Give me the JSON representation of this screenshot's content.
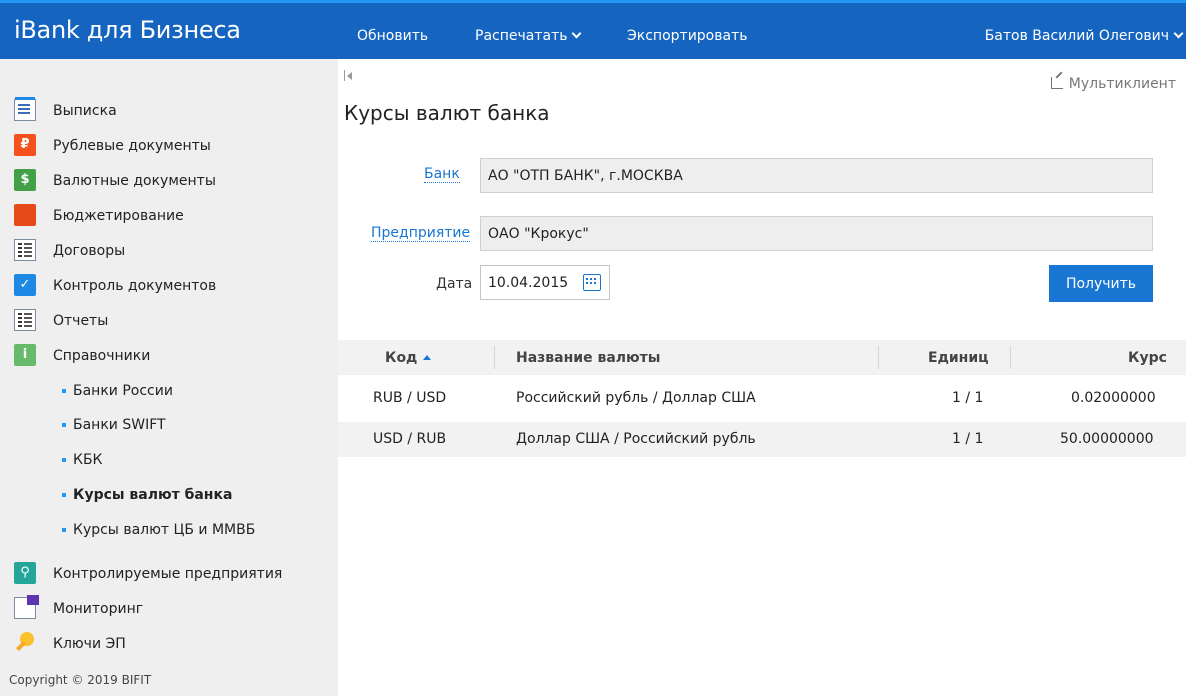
{
  "app": {
    "title": "iBank для Бизнеса"
  },
  "topnav": {
    "refresh": "Обновить",
    "print": "Распечатать",
    "export": "Экспортировать",
    "user": "Батов Василий Олегович"
  },
  "sidebar": {
    "items": [
      {
        "label": "Выписка",
        "icon": "statement-icon"
      },
      {
        "label": "Рублевые документы",
        "icon": "ruble-documents-icon"
      },
      {
        "label": "Валютные документы",
        "icon": "currency-documents-icon"
      },
      {
        "label": "Бюджетирование",
        "icon": "budget-icon"
      },
      {
        "label": "Договоры",
        "icon": "contracts-icon"
      },
      {
        "label": "Контроль документов",
        "icon": "document-control-icon"
      },
      {
        "label": "Отчеты",
        "icon": "reports-icon"
      },
      {
        "label": "Справочники",
        "icon": "directories-icon"
      }
    ],
    "subitems": [
      {
        "label": "Банки России"
      },
      {
        "label": "Банки SWIFT"
      },
      {
        "label": "КБК"
      },
      {
        "label": "Курсы валют банка",
        "active": true
      },
      {
        "label": "Курсы валют ЦБ и ММВБ"
      }
    ],
    "items_bottom": [
      {
        "label": "Контролируемые предприятия",
        "icon": "controlled-companies-icon"
      },
      {
        "label": "Мониторинг",
        "icon": "monitoring-icon"
      },
      {
        "label": "Ключи ЭП",
        "icon": "key-icon"
      }
    ],
    "copyright": "Copyright © 2019 BIFIT"
  },
  "main": {
    "multiclient": "Мультиклиент",
    "title": "Курсы валют банка",
    "bank_label": "Банк",
    "bank_value": "АО \"ОТП БАНК\", г.МОСКВА",
    "company_label": "Предприятие",
    "company_value": "ОАО \"Крокус\"",
    "date_label": "Дата",
    "date_value": "10.04.2015",
    "get_button": "Получить"
  },
  "table": {
    "columns": [
      "Код",
      "Название валюты",
      "Единиц",
      "Курс"
    ],
    "sort_column": "Код",
    "sort_dir": "asc",
    "rows": [
      {
        "code": "RUB / USD",
        "name": "Российский рубль / Доллар США",
        "units": "1 / 1",
        "rate": "0.02000000"
      },
      {
        "code": "USD / RUB",
        "name": "Доллар США / Российский рубль",
        "units": "1 / 1",
        "rate": "50.00000000"
      }
    ]
  },
  "colors": {
    "brand": "#1565c0",
    "accent": "#1976d2",
    "sidebar_bg": "#efefef"
  }
}
